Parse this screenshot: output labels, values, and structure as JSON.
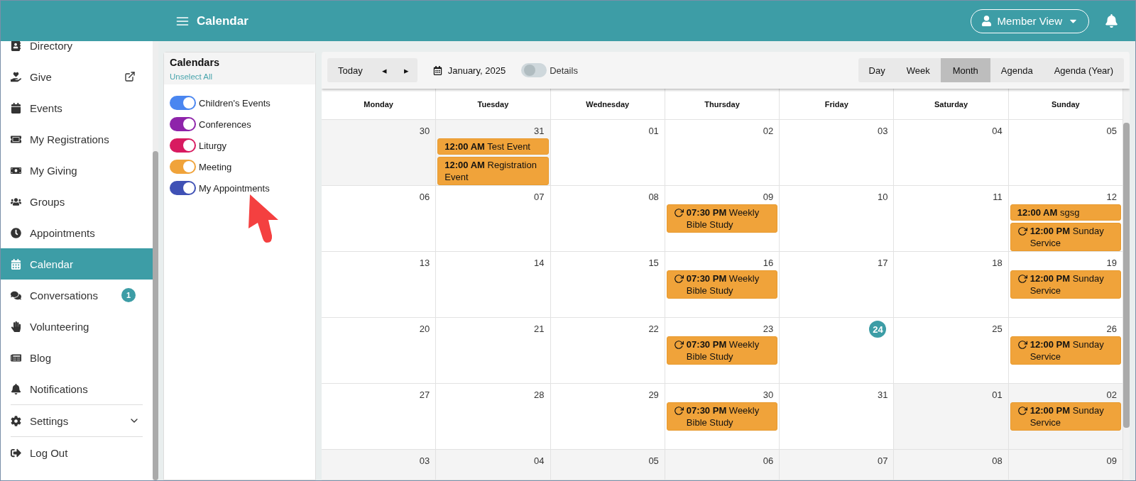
{
  "topbar": {
    "title": "Calendar",
    "view_button": "Member View"
  },
  "sidebar": {
    "items": [
      {
        "label": "Directory",
        "selected": false
      },
      {
        "label": "Give",
        "selected": false,
        "external": true
      },
      {
        "label": "Events",
        "selected": false
      },
      {
        "label": "My Registrations",
        "selected": false
      },
      {
        "label": "My Giving",
        "selected": false
      },
      {
        "label": "Groups",
        "selected": false
      },
      {
        "label": "Appointments",
        "selected": false
      },
      {
        "label": "Calendar",
        "selected": true
      },
      {
        "label": "Conversations",
        "selected": false,
        "badge": "1"
      },
      {
        "label": "Volunteering",
        "selected": false
      },
      {
        "label": "Blog",
        "selected": false
      },
      {
        "label": "Notifications",
        "selected": false
      },
      {
        "label": "Settings",
        "selected": false,
        "expandable": true,
        "divider": true
      },
      {
        "label": "Log Out",
        "selected": false,
        "divider": true
      }
    ]
  },
  "calendars_panel": {
    "title": "Calendars",
    "unselect_link": "Unselect All",
    "calendars": [
      {
        "name": "Children's Events",
        "on": true,
        "color": "#4a86f0"
      },
      {
        "name": "Conferences",
        "on": true,
        "color": "#8e24aa"
      },
      {
        "name": "Liturgy",
        "on": true,
        "color": "#d81b60"
      },
      {
        "name": "Meeting",
        "on": true,
        "color": "#f0a33a"
      },
      {
        "name": "My Appointments",
        "on": true,
        "color": "#3f51b5"
      }
    ]
  },
  "toolbar": {
    "today": "Today",
    "prev": "◂",
    "next": "▸",
    "month": "January, 2025",
    "details": {
      "label": "Details",
      "on": false
    },
    "views": [
      {
        "label": "Day",
        "selected": false
      },
      {
        "label": "Week",
        "selected": false
      },
      {
        "label": "Month",
        "selected": true
      },
      {
        "label": "Agenda",
        "selected": false
      },
      {
        "label": "Agenda (Year)",
        "selected": false
      }
    ]
  },
  "weekdays": [
    "Monday",
    "Tuesday",
    "Wednesday",
    "Thursday",
    "Friday",
    "Saturday",
    "Sunday"
  ],
  "weeks": [
    [
      {
        "day": "30",
        "outside": true
      },
      {
        "day": "31",
        "outside": true,
        "events": [
          {
            "time": "12:00 AM",
            "title": "Test Event",
            "recurring": false
          },
          {
            "time": "12:00 AM",
            "title": "Registration Event",
            "recurring": false
          }
        ]
      },
      {
        "day": "01"
      },
      {
        "day": "02"
      },
      {
        "day": "03"
      },
      {
        "day": "04"
      },
      {
        "day": "05"
      }
    ],
    [
      {
        "day": "06"
      },
      {
        "day": "07"
      },
      {
        "day": "08"
      },
      {
        "day": "09",
        "events": [
          {
            "time": "07:30 PM",
            "title": "Weekly Bible Study",
            "recurring": true
          }
        ]
      },
      {
        "day": "10"
      },
      {
        "day": "11"
      },
      {
        "day": "12",
        "events": [
          {
            "time": "12:00 AM",
            "title": "sgsg",
            "recurring": false
          },
          {
            "time": "12:00 PM",
            "title": "Sunday Service",
            "recurring": true
          }
        ]
      }
    ],
    [
      {
        "day": "13"
      },
      {
        "day": "14"
      },
      {
        "day": "15"
      },
      {
        "day": "16",
        "events": [
          {
            "time": "07:30 PM",
            "title": "Weekly Bible Study",
            "recurring": true
          }
        ]
      },
      {
        "day": "17"
      },
      {
        "day": "18"
      },
      {
        "day": "19",
        "events": [
          {
            "time": "12:00 PM",
            "title": "Sunday Service",
            "recurring": true
          }
        ]
      }
    ],
    [
      {
        "day": "20"
      },
      {
        "day": "21"
      },
      {
        "day": "22"
      },
      {
        "day": "23",
        "events": [
          {
            "time": "07:30 PM",
            "title": "Weekly Bible Study",
            "recurring": true
          }
        ]
      },
      {
        "day": "24",
        "today": true
      },
      {
        "day": "25"
      },
      {
        "day": "26",
        "events": [
          {
            "time": "12:00 PM",
            "title": "Sunday Service",
            "recurring": true
          }
        ]
      }
    ],
    [
      {
        "day": "27"
      },
      {
        "day": "28"
      },
      {
        "day": "29"
      },
      {
        "day": "30",
        "events": [
          {
            "time": "07:30 PM",
            "title": "Weekly Bible Study",
            "recurring": true
          }
        ]
      },
      {
        "day": "31"
      },
      {
        "day": "01",
        "outside": true
      },
      {
        "day": "02",
        "outside": true,
        "events": [
          {
            "time": "12:00 PM",
            "title": "Sunday Service",
            "recurring": true
          }
        ]
      }
    ],
    [
      {
        "day": "03",
        "outside": true
      },
      {
        "day": "04",
        "outside": true
      },
      {
        "day": "05",
        "outside": true
      },
      {
        "day": "06",
        "outside": true
      },
      {
        "day": "07",
        "outside": true
      },
      {
        "day": "08",
        "outside": true
      },
      {
        "day": "09",
        "outside": true
      }
    ]
  ]
}
